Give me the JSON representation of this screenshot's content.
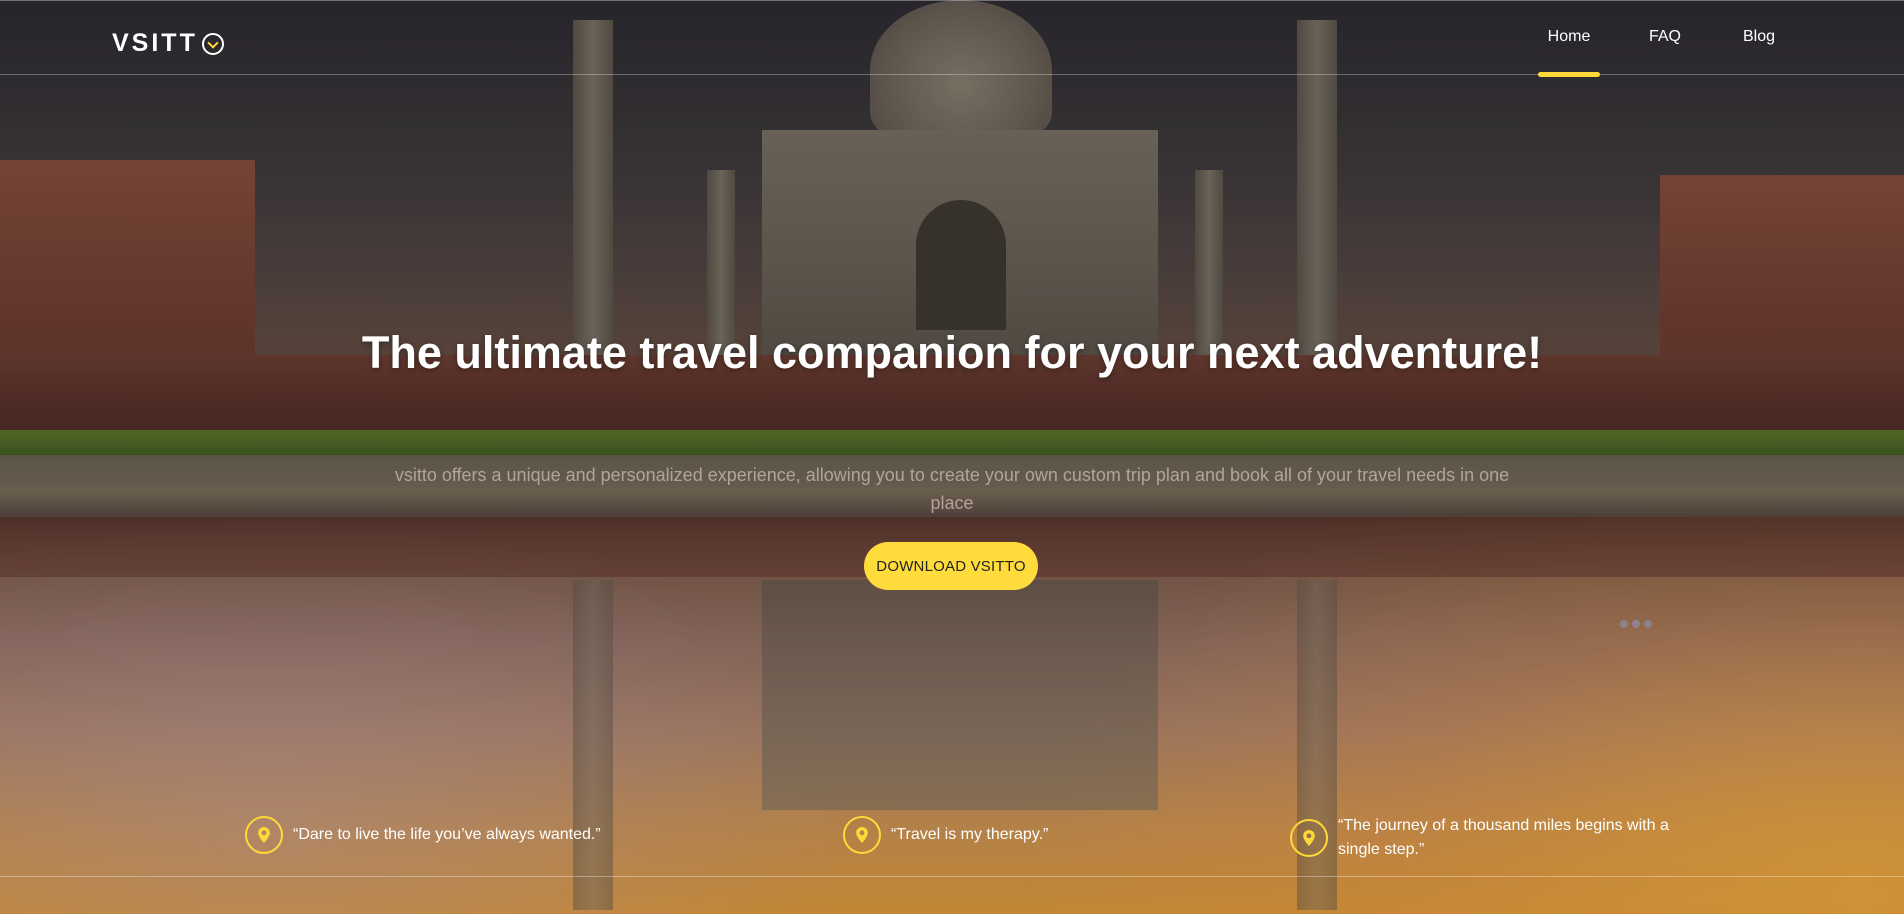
{
  "brand": {
    "logo_text": "VSITT"
  },
  "nav": {
    "items": [
      {
        "label": "Home",
        "active": true
      },
      {
        "label": "FAQ",
        "active": false
      },
      {
        "label": "Blog",
        "active": false
      }
    ]
  },
  "hero": {
    "headline": "The ultimate travel companion for your next adventure!",
    "subtext": "vsitto offers a unique and personalized experience, allowing you to create your own custom trip plan and book all of your travel needs in one place",
    "cta_label": "DOWNLOAD VSITTO"
  },
  "quotes": [
    {
      "text": "“Dare to live the life you’ve always wanted.”",
      "icon": "map-pin-icon"
    },
    {
      "text": "“Travel is my therapy.”",
      "icon": "map-pin-icon"
    },
    {
      "text": "“The journey of a thousand miles begins with a single step.”",
      "icon": "map-pin-icon"
    }
  ],
  "colors": {
    "accent": "#ffdc3c",
    "text": "#ffffff"
  }
}
